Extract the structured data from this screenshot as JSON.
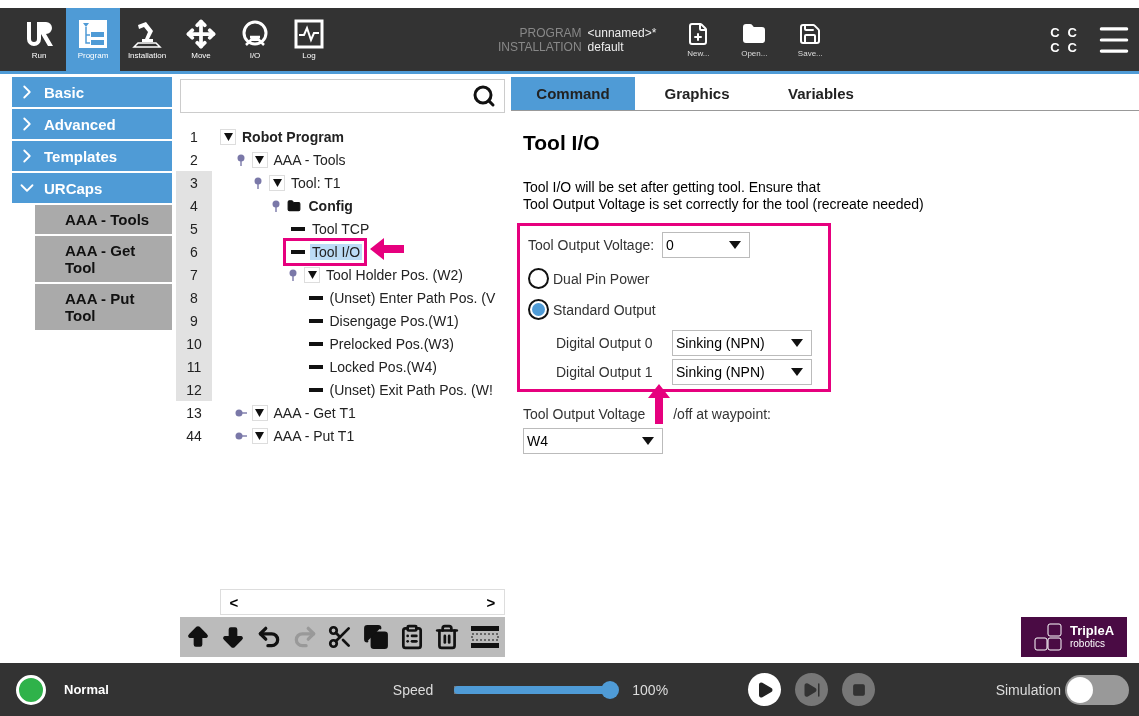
{
  "top_bar": {
    "nav": [
      {
        "kind": "run",
        "label": "Run",
        "selected": false
      },
      {
        "kind": "program",
        "label": "Program",
        "selected": true
      },
      {
        "kind": "installation",
        "label": "Installation",
        "selected": false
      },
      {
        "kind": "move",
        "label": "Move",
        "selected": false
      },
      {
        "kind": "io",
        "label": "I/O",
        "selected": false
      },
      {
        "kind": "log",
        "label": "Log",
        "selected": false
      }
    ],
    "program_label": "PROGRAM",
    "program_value": "<unnamed>*",
    "installation_label": "INSTALLATION",
    "installation_value": "default",
    "file_buttons": [
      {
        "kind": "new",
        "label": "New..."
      },
      {
        "kind": "open",
        "label": "Open..."
      },
      {
        "kind": "save",
        "label": "Save..."
      }
    ],
    "status_glyphs": [
      "C",
      "C",
      "C",
      "C"
    ]
  },
  "sidebar": {
    "items": [
      {
        "label": "Basic",
        "expanded": false
      },
      {
        "label": "Advanced",
        "expanded": false
      },
      {
        "label": "Templates",
        "expanded": false
      },
      {
        "label": "URCaps",
        "expanded": true,
        "children": [
          "AAA - Tools",
          "AAA - Get Tool",
          "AAA - Put Tool"
        ]
      }
    ]
  },
  "tree": {
    "items": [
      {
        "line": "1",
        "label": "Robot Program",
        "kind": "root",
        "expanded": true,
        "selected": false,
        "shaded": false,
        "children": [
          {
            "line": "2",
            "label": "AAA - Tools",
            "kind": "group",
            "expanded": true,
            "selected": false,
            "shaded": false,
            "children": [
              {
                "line": "3",
                "label": "Tool: T1",
                "kind": "group",
                "expanded": true,
                "selected": false,
                "shaded": true,
                "children": [
                  {
                    "line": "4",
                    "label": "Config",
                    "kind": "folder",
                    "expanded": true,
                    "selected": false,
                    "shaded": true,
                    "children": [
                      {
                        "line": "5",
                        "label": "Tool TCP",
                        "kind": "leaf",
                        "selected": false,
                        "shaded": true
                      },
                      {
                        "line": "6",
                        "label": "Tool I/O",
                        "kind": "leaf",
                        "selected": true,
                        "shaded": true
                      },
                      {
                        "line": "7",
                        "label": "Tool Holder Pos. (W2)",
                        "kind": "group",
                        "expanded": true,
                        "selected": false,
                        "shaded": true,
                        "children": [
                          {
                            "line": "8",
                            "label": "(Unset) Enter Path Pos. (V",
                            "kind": "leaf",
                            "selected": false,
                            "shaded": true
                          },
                          {
                            "line": "9",
                            "label": "Disengage Pos.(W1)",
                            "kind": "leaf",
                            "selected": false,
                            "shaded": true
                          },
                          {
                            "line": "10",
                            "label": "Prelocked Pos.(W3)",
                            "kind": "leaf",
                            "selected": false,
                            "shaded": true
                          },
                          {
                            "line": "11",
                            "label": "Locked Pos.(W4)",
                            "kind": "leaf",
                            "selected": false,
                            "shaded": true
                          },
                          {
                            "line": "12",
                            "label": "(Unset) Exit Path Pos. (W!",
                            "kind": "leaf",
                            "selected": false,
                            "shaded": true
                          }
                        ]
                      }
                    ]
                  }
                ]
              }
            ]
          },
          {
            "line": "13",
            "label": "AAA - Get T1",
            "kind": "group",
            "expanded": false,
            "selected": false,
            "shaded": false
          },
          {
            "line": "44",
            "label": "AAA - Put T1",
            "kind": "group",
            "expanded": false,
            "selected": false,
            "shaded": false
          }
        ]
      }
    ],
    "scroll_left": "<",
    "scroll_right": ">",
    "toolbar": [
      {
        "kind": "up",
        "disabled": false
      },
      {
        "kind": "down",
        "disabled": false
      },
      {
        "kind": "undo",
        "disabled": false
      },
      {
        "kind": "redo",
        "disabled": true
      },
      {
        "kind": "cut",
        "disabled": false
      },
      {
        "kind": "copy",
        "disabled": false
      },
      {
        "kind": "paste",
        "disabled": false
      },
      {
        "kind": "delete",
        "disabled": false
      },
      {
        "kind": "suppress",
        "disabled": false
      }
    ]
  },
  "tabs": [
    {
      "label": "Command",
      "selected": true
    },
    {
      "label": "Graphics",
      "selected": false
    },
    {
      "label": "Variables",
      "selected": false
    }
  ],
  "panel": {
    "title": "Tool I/O",
    "description": [
      "Tool I/O will be set after getting tool. Ensure that",
      "Tool Output Voltage is set correctly for the tool (recreate needed)"
    ],
    "voltage_label": "Tool Output Voltage:",
    "voltage_value": "0",
    "radios": [
      {
        "label": "Dual Pin Power",
        "selected": false
      },
      {
        "label": "Standard Output",
        "selected": true
      }
    ],
    "outputs": [
      {
        "label": "Digital Output 0",
        "value": "Sinking (NPN)"
      },
      {
        "label": "Digital Output 1",
        "value": "Sinking (NPN)"
      }
    ],
    "waypoint_label_start": "Tool Output Voltage",
    "waypoint_label_end": "/off at waypoint:",
    "waypoint_value": "W4",
    "logo_title": "TripleA",
    "logo_subtitle": "robotics"
  },
  "status_bar": {
    "status": {
      "text": "Normal",
      "color": "#2fb24a"
    },
    "speed_label": "Speed",
    "speed": {
      "level": 1
    },
    "speed_value": "100%",
    "simulation_label": "Simulation",
    "simulation_on": false
  }
}
